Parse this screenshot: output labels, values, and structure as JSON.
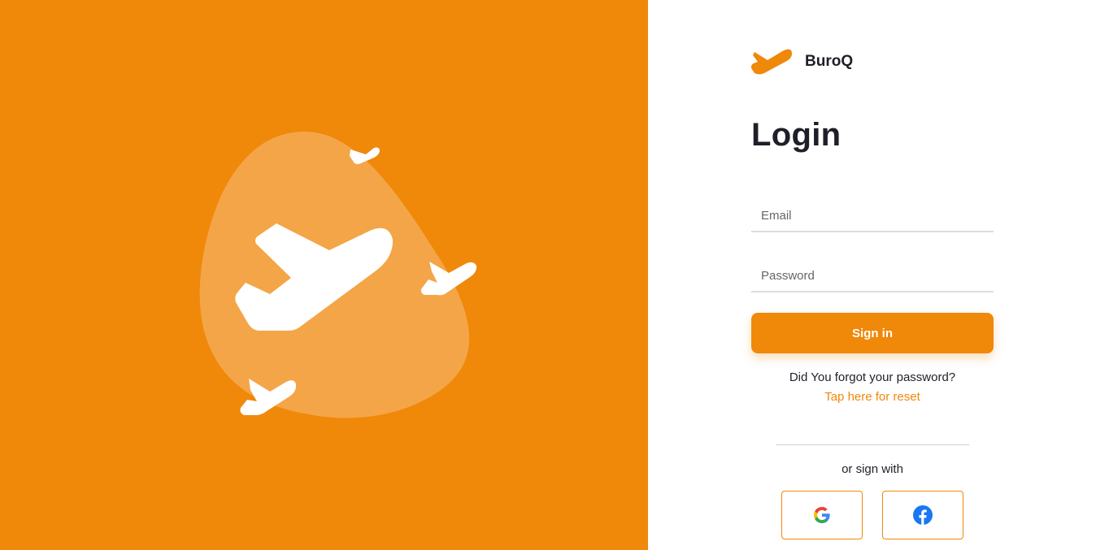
{
  "brand": {
    "name": "BuroQ",
    "logo_icon": "airplane-icon",
    "accent_color": "#f0880a"
  },
  "login": {
    "title": "Login",
    "email_placeholder": "Email",
    "password_placeholder": "Password",
    "signin_label": "Sign in",
    "forgot_text": "Did You forgot your password?",
    "reset_link": "Tap here for reset",
    "or_text": "or sign with"
  },
  "social": [
    {
      "name": "google",
      "icon": "google-icon"
    },
    {
      "name": "facebook",
      "icon": "facebook-icon"
    }
  ],
  "illustration": {
    "background_color": "#f0880a",
    "blob_color": "#f4a547",
    "plane_color": "#ffffff"
  }
}
